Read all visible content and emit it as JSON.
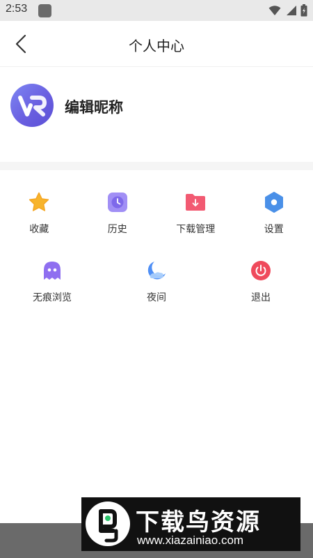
{
  "status_bar": {
    "time": "2:53"
  },
  "header": {
    "title": "个人中心"
  },
  "profile": {
    "nickname": "编辑昵称"
  },
  "menu": {
    "row1": [
      {
        "label": "收藏",
        "icon": "star-icon",
        "color": "#f5a623"
      },
      {
        "label": "历史",
        "icon": "clock-icon",
        "color": "#8e7cf0"
      },
      {
        "label": "下载管理",
        "icon": "download-folder-icon",
        "color": "#f04f6a"
      },
      {
        "label": "设置",
        "icon": "hexagon-settings-icon",
        "color": "#4a90e8"
      }
    ],
    "row2": [
      {
        "label": "无痕浏览",
        "icon": "ghost-icon",
        "color": "#8f6ff0"
      },
      {
        "label": "夜间",
        "icon": "moon-icon",
        "color": "#4f8ff5"
      },
      {
        "label": "退出",
        "icon": "power-icon",
        "color": "#ef4a5c"
      }
    ]
  },
  "watermark": {
    "title": "下载鸟资源",
    "url": "www.xiazainiao.com"
  }
}
